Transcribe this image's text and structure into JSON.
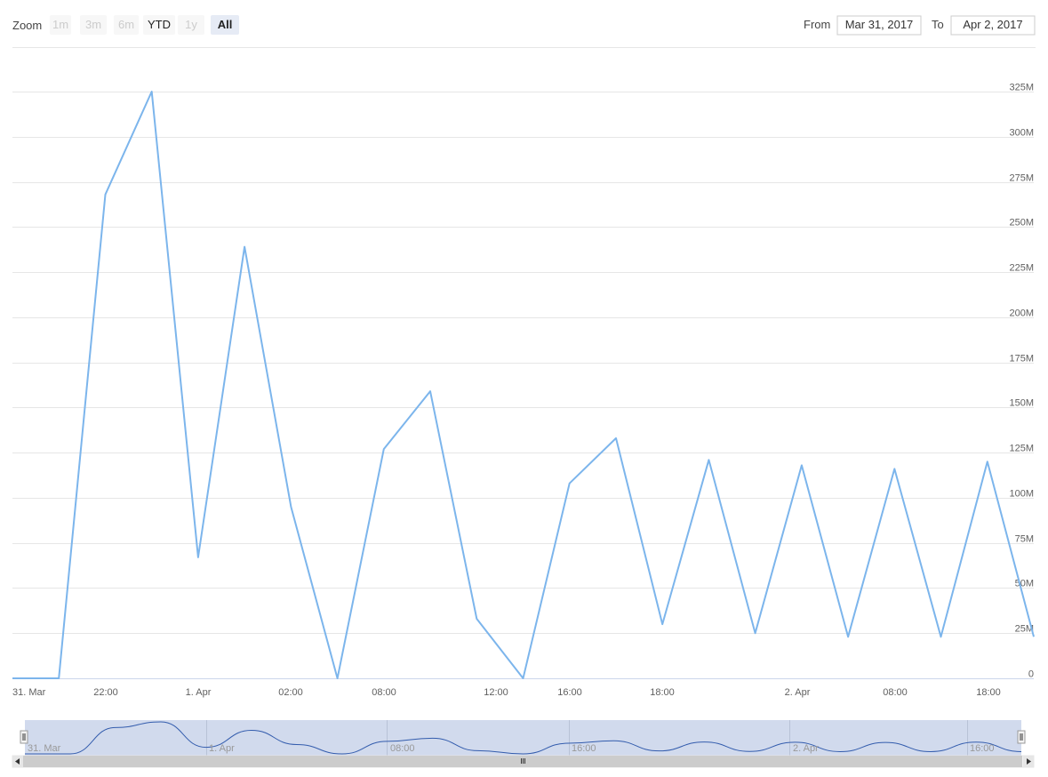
{
  "range_selector": {
    "zoom_label": "Zoom",
    "buttons": [
      {
        "label": "1m",
        "state": "disabled"
      },
      {
        "label": "3m",
        "state": "disabled"
      },
      {
        "label": "6m",
        "state": "disabled"
      },
      {
        "label": "YTD",
        "state": "normal"
      },
      {
        "label": "1y",
        "state": "disabled"
      },
      {
        "label": "All",
        "state": "selected"
      }
    ],
    "from_label": "From",
    "from_value": "Mar 31, 2017",
    "to_label": "To",
    "to_value": "Apr 2, 2017"
  },
  "chart_data": {
    "type": "line",
    "x_tick_labels": [
      "31. Mar",
      "22:00",
      "1. Apr",
      "02:00",
      "08:00",
      "12:00",
      "16:00",
      "18:00",
      "2. Apr",
      "08:00",
      "18:00"
    ],
    "y_tick_labels": [
      "0",
      "25M",
      "50M",
      "75M",
      "100M",
      "125M",
      "150M",
      "175M",
      "200M",
      "225M",
      "250M",
      "275M",
      "300M",
      "325M"
    ],
    "ylim": [
      0,
      325000000
    ],
    "y_tick_step": 25000000,
    "series": [
      {
        "color": "#7cb5ec",
        "values": [
          0,
          0,
          268000000,
          325000000,
          67000000,
          239000000,
          95000000,
          0,
          127000000,
          159000000,
          33000000,
          0,
          108000000,
          133000000,
          30000000,
          121000000,
          25000000,
          118000000,
          23000000,
          116000000,
          23000000,
          120000000,
          23000000
        ]
      }
    ],
    "grid": true
  },
  "navigator": {
    "x_labels": [
      "31. Mar",
      "1. Apr",
      "08:00",
      "16:00",
      "2. Apr",
      "16:00"
    ],
    "mask_fill": "#ccd6eb",
    "line_color": "#335cad"
  },
  "colors": {
    "line": "#7cb5ec",
    "grid": "#e6e6e6",
    "selected_button": "#e6ebf5"
  }
}
